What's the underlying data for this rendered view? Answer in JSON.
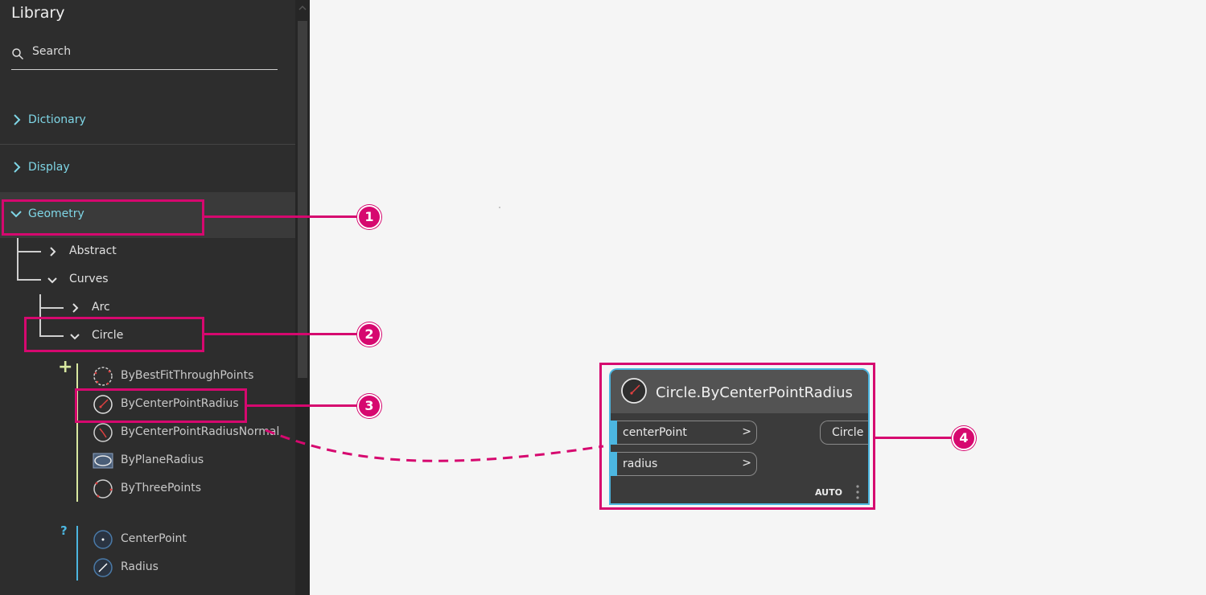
{
  "library": {
    "title": "Library",
    "search_placeholder": "Search",
    "categories": {
      "dictionary": "Dictionary",
      "display": "Display",
      "geometry": "Geometry"
    },
    "tree": {
      "abstract": "Abstract",
      "curves": "Curves",
      "arc": "Arc",
      "circle": "Circle"
    },
    "create_items": [
      {
        "label": "ByBestFitThroughPoints",
        "icon": "circle-dashed-icon"
      },
      {
        "label": "ByCenterPointRadius",
        "icon": "circle-radius-icon"
      },
      {
        "label": "ByCenterPointRadiusNormal",
        "icon": "circle-normal-icon"
      },
      {
        "label": "ByPlaneRadius",
        "icon": "plane-circle-icon"
      },
      {
        "label": "ByThreePoints",
        "icon": "three-points-circle-icon"
      }
    ],
    "create_symbol": "+",
    "query_symbol": "?",
    "query_items": [
      {
        "label": "CenterPoint",
        "icon": "center-point-icon"
      },
      {
        "label": "Radius",
        "icon": "radius-icon"
      }
    ]
  },
  "node": {
    "title": "Circle.ByCenterPointRadius",
    "inputs": [
      {
        "label": "centerPoint",
        "arrow": ">"
      },
      {
        "label": "radius",
        "arrow": ">"
      }
    ],
    "output": "Circle",
    "lacing": "AUTO"
  },
  "callouts": [
    "1",
    "2",
    "3",
    "4"
  ],
  "colors": {
    "accent": "#d6086f",
    "category_text": "#7fd6e6",
    "port_bar": "#4cb6e0"
  }
}
